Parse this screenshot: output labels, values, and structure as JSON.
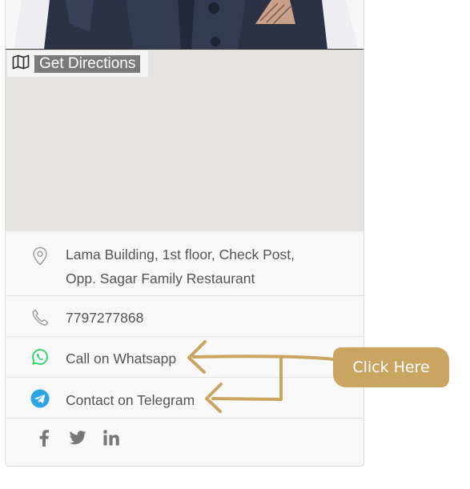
{
  "directions": {
    "label": "Get Directions",
    "icon": "map-icon"
  },
  "contact": {
    "address_line1": "Lama Building, 1st floor, Check Post,",
    "address_line2": "Opp. Sagar Family Restaurant",
    "phone": "7797277868",
    "whatsapp_label": "Call on Whatsapp",
    "telegram_label": "Contact on Telegram"
  },
  "social": {
    "icons": [
      "facebook-icon",
      "twitter-icon",
      "linkedin-icon"
    ]
  },
  "annotation": {
    "badge_label": "Click Here"
  },
  "colors": {
    "whatsapp": "#25d366",
    "telegram": "#2ca5e0",
    "annotation": "#c9a561",
    "icon_gray": "#888888",
    "map_bg": "#e5e3df"
  }
}
